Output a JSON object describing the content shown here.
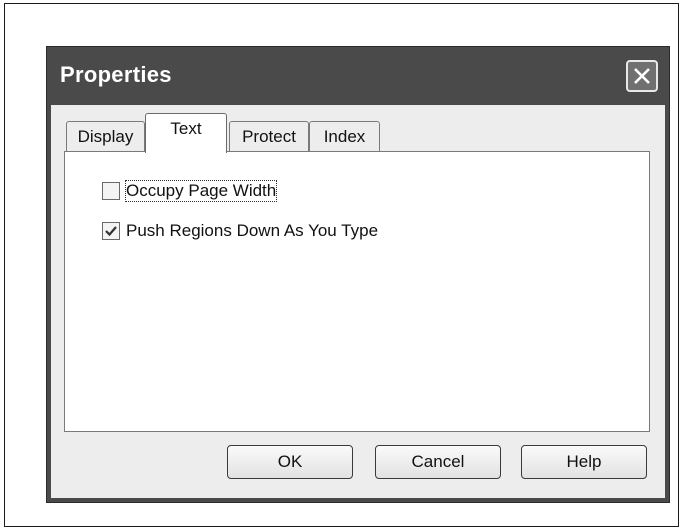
{
  "dialog": {
    "title": "Properties",
    "close_icon": "close-icon"
  },
  "tabs": [
    {
      "label": "Display",
      "active": false
    },
    {
      "label": "Text",
      "active": true
    },
    {
      "label": "Protect",
      "active": false
    },
    {
      "label": "Index",
      "active": false
    }
  ],
  "options": {
    "occupy": {
      "label": "Occupy Page Width",
      "checked": false
    },
    "push": {
      "label": "Push Regions Down As You Type",
      "checked": true
    }
  },
  "buttons": {
    "ok": "OK",
    "cancel": "Cancel",
    "help": "Help"
  }
}
